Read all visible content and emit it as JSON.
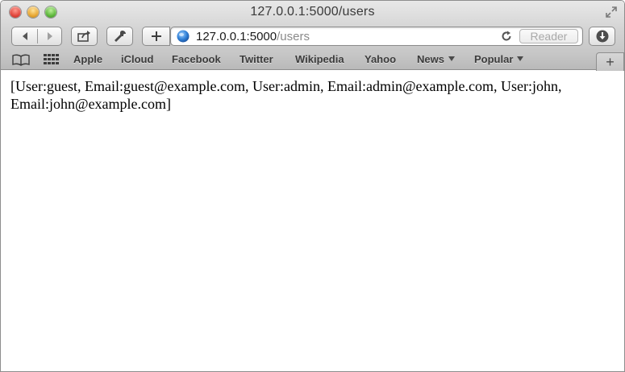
{
  "window": {
    "title": "127.0.0.1:5000/users"
  },
  "toolbar": {
    "back_icon": "back-arrow-icon",
    "forward_icon": "forward-arrow-icon",
    "share_icon": "share-icon",
    "tools_icon": "wrench-icon",
    "add_icon": "plus-icon",
    "downloads_icon": "download-icon"
  },
  "address_bar": {
    "host": "127.0.0.1:5000",
    "path": "/users",
    "reader_label": "Reader"
  },
  "bookmarks": {
    "items": [
      "Apple",
      "iCloud",
      "Facebook",
      "Twitter",
      "Wikipedia",
      "Yahoo",
      "News",
      "Popular"
    ]
  },
  "page": {
    "text": "[User:guest, Email:guest@example.com, User:admin, Email:admin@example.com, User:john, Email:john@example.com]"
  }
}
